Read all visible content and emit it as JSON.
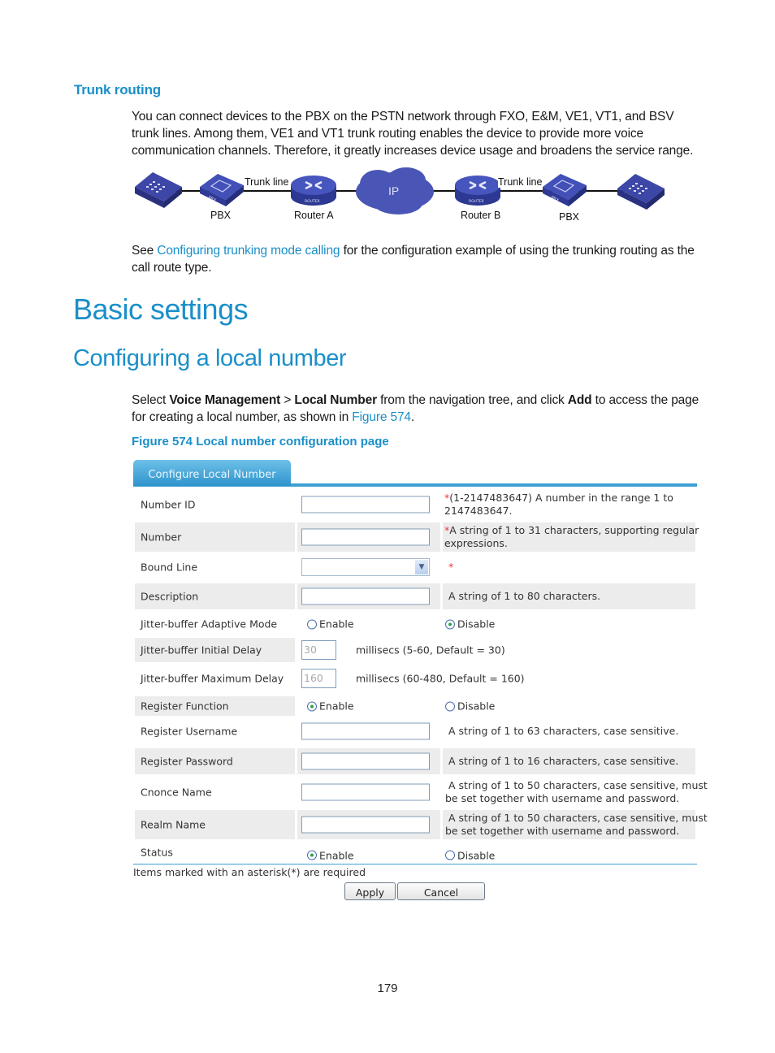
{
  "section_trunk": {
    "heading": "Trunk routing",
    "paragraph": "You can connect devices to the PBX on the PSTN network through FXO, E&M, VE1, VT1, and BSV trunk lines. Among them, VE1 and VT1 trunk routing enables the device to provide more voice communication channels. Therefore, it greatly increases device usage and broadens the service range.",
    "see_prefix": "See ",
    "see_link": "Configuring trunking mode calling",
    "see_suffix": " for the configuration example of using the trunking routing as the call route type."
  },
  "diagram": {
    "trunk_line_left": "Trunk line",
    "trunk_line_right": "Trunk line",
    "pbx_left": "PBX",
    "router_a": "Router A",
    "ip_cloud": "IP",
    "router_b": "Router B",
    "pbx_right": "PBX",
    "pbx_chip_text": "PBX",
    "router_chip_text": "ROUTER"
  },
  "basic_settings": {
    "title": "Basic settings"
  },
  "local_number": {
    "title": "Configuring a local number",
    "intro_select": "Select ",
    "intro_b1": "Voice Management",
    "intro_gt": " > ",
    "intro_b2": "Local Number",
    "intro_mid": " from the navigation tree, and click ",
    "intro_b3": "Add",
    "intro_end": " to access the page for creating a local number, as shown in ",
    "intro_link": "Figure 574",
    "intro_period": ".",
    "figure_caption": "Figure 574 Local number configuration page"
  },
  "form": {
    "tab_label": "Configure Local Number",
    "asterisk": "*",
    "fields": {
      "number_id": {
        "label": "Number ID",
        "value": "",
        "hint_line1": "(1-2147483647) A number in the range 1 to",
        "hint_line2": "2147483647."
      },
      "number": {
        "label": "Number",
        "value": "",
        "hint_line1": "A string of 1 to 31 characters, supporting regular",
        "hint_line2": "expressions."
      },
      "bound_line": {
        "label": "Bound Line",
        "value": ""
      },
      "description": {
        "label": "Description",
        "value": "",
        "hint": "A string of 1 to 80 characters."
      },
      "jitter_mode": {
        "label": "Jitter-buffer Adaptive Mode",
        "opt_enable": "Enable",
        "opt_disable": "Disable",
        "selected": "Disable"
      },
      "jitter_initial": {
        "label": "Jitter-buffer Initial Delay",
        "value": "30",
        "hint": "millisecs (5-60, Default = 30)"
      },
      "jitter_max": {
        "label": "Jitter-buffer Maximum Delay",
        "value": "160",
        "hint": "millisecs (60-480, Default = 160)"
      },
      "register_function": {
        "label": "Register Function",
        "opt_enable": "Enable",
        "opt_disable": "Disable",
        "selected": "Enable"
      },
      "register_username": {
        "label": "Register Username",
        "value": "",
        "hint": "A string of 1 to 63 characters, case sensitive."
      },
      "register_password": {
        "label": "Register Password",
        "value": "",
        "hint": "A string of 1 to 16 characters, case sensitive."
      },
      "cnonce_name": {
        "label": "Cnonce Name",
        "value": "",
        "hint_line1": "A string of 1 to 50 characters, case sensitive, must",
        "hint_line2": "be set together with username and password."
      },
      "realm_name": {
        "label": "Realm Name",
        "value": "",
        "hint_line1": "A string of 1 to 50 characters, case sensitive, must",
        "hint_line2": "be set together with username and password."
      },
      "status": {
        "label": "Status",
        "opt_enable": "Enable",
        "opt_disable": "Disable",
        "selected": "Enable"
      }
    },
    "required_note": "Items marked with an asterisk(*) are required",
    "apply_label": "Apply",
    "cancel_label": "Cancel"
  },
  "page_number": "179"
}
